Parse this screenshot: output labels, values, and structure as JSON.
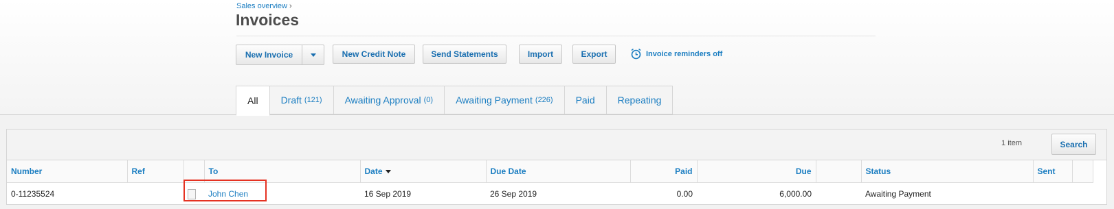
{
  "breadcrumb": {
    "parent": "Sales overview",
    "separator": "›"
  },
  "page_title": "Invoices",
  "toolbar": {
    "new_invoice": "New Invoice",
    "new_credit_note": "New Credit Note",
    "send_statements": "Send Statements",
    "import": "Import",
    "export": "Export",
    "reminders": "Invoice reminders off"
  },
  "tabs": [
    {
      "label": "All",
      "count": ""
    },
    {
      "label": "Draft",
      "count": "(121)"
    },
    {
      "label": "Awaiting Approval",
      "count": "(0)"
    },
    {
      "label": "Awaiting Payment",
      "count": "(226)"
    },
    {
      "label": "Paid",
      "count": ""
    },
    {
      "label": "Repeating",
      "count": ""
    }
  ],
  "list": {
    "item_count": "1 item",
    "search_label": "Search",
    "columns": {
      "number": "Number",
      "ref": "Ref",
      "to": "To",
      "date": "Date",
      "due_date": "Due Date",
      "paid": "Paid",
      "due": "Due",
      "status": "Status",
      "sent": "Sent"
    },
    "rows": [
      {
        "number": "0-11235524",
        "ref": "",
        "to": "John Chen",
        "date": "16 Sep 2019",
        "due_date": "26 Sep 2019",
        "paid": "0.00",
        "due": "6,000.00",
        "status": "Awaiting Payment",
        "sent": ""
      }
    ]
  },
  "colors": {
    "accent": "#1a7dc1",
    "highlight": "#e53222"
  }
}
